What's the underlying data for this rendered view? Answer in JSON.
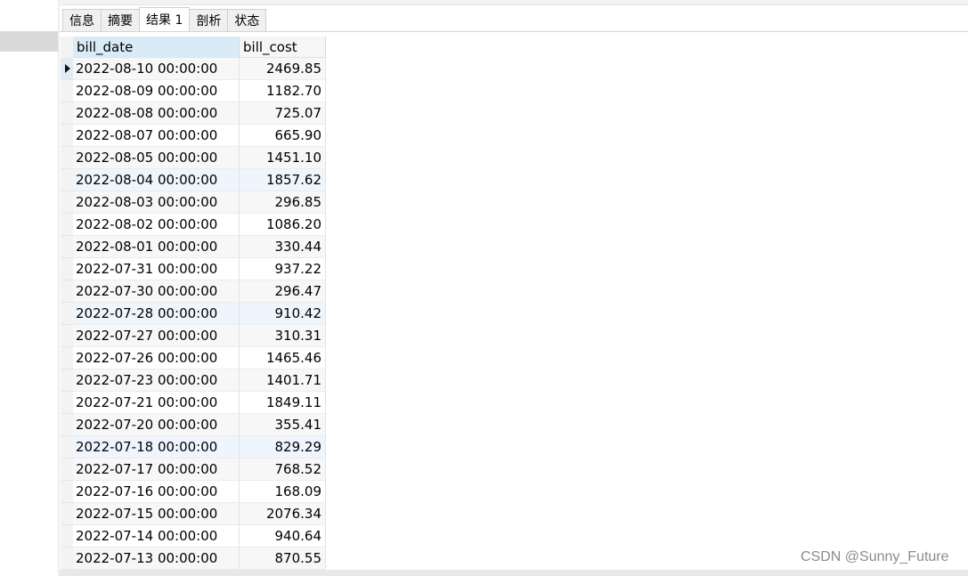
{
  "tabs": [
    {
      "label": "信息"
    },
    {
      "label": "摘要"
    },
    {
      "label": "结果 1",
      "active": true
    },
    {
      "label": "剖析"
    },
    {
      "label": "状态"
    }
  ],
  "grid": {
    "columns": [
      "bill_date",
      "bill_cost"
    ],
    "rows": [
      [
        "2022-08-10 00:00:00",
        "2469.85"
      ],
      [
        "2022-08-09 00:00:00",
        "1182.70"
      ],
      [
        "2022-08-08 00:00:00",
        "725.07"
      ],
      [
        "2022-08-07 00:00:00",
        "665.90"
      ],
      [
        "2022-08-05 00:00:00",
        "1451.10"
      ],
      [
        "2022-08-04 00:00:00",
        "1857.62"
      ],
      [
        "2022-08-03 00:00:00",
        "296.85"
      ],
      [
        "2022-08-02 00:00:00",
        "1086.20"
      ],
      [
        "2022-08-01 00:00:00",
        "330.44"
      ],
      [
        "2022-07-31 00:00:00",
        "937.22"
      ],
      [
        "2022-07-30 00:00:00",
        "296.47"
      ],
      [
        "2022-07-28 00:00:00",
        "910.42"
      ],
      [
        "2022-07-27 00:00:00",
        "310.31"
      ],
      [
        "2022-07-26 00:00:00",
        "1465.46"
      ],
      [
        "2022-07-23 00:00:00",
        "1401.71"
      ],
      [
        "2022-07-21 00:00:00",
        "1849.11"
      ],
      [
        "2022-07-20 00:00:00",
        "355.41"
      ],
      [
        "2022-07-18 00:00:00",
        "829.29"
      ],
      [
        "2022-07-17 00:00:00",
        "768.52"
      ],
      [
        "2022-07-16 00:00:00",
        "168.09"
      ],
      [
        "2022-07-15 00:00:00",
        "2076.34"
      ],
      [
        "2022-07-14 00:00:00",
        "940.64"
      ],
      [
        "2022-07-13 00:00:00",
        "870.55"
      ]
    ]
  },
  "watermark": "CSDN @Sunny_Future"
}
